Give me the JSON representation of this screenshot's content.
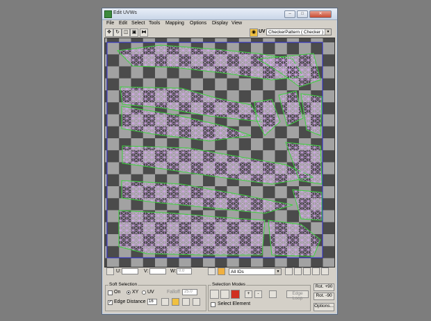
{
  "window": {
    "title": "Edit UVWs"
  },
  "menu": [
    "File",
    "Edit",
    "Select",
    "Tools",
    "Mapping",
    "Options",
    "Display",
    "View"
  ],
  "toolbar": {
    "uv_label": "UV",
    "texture_dropdown": "CheckerPattern  ( Checker )"
  },
  "statusbar": {
    "u_label": "U:",
    "v_label": "V:",
    "w_label": "W:",
    "w_value": "0.0",
    "ids_dropdown": "All IDs"
  },
  "soft_selection": {
    "title": "Soft Selection",
    "on_label": "On",
    "xy_label": "XY",
    "uv_label": "UV",
    "falloff_label": "Falloff",
    "falloff_value": "25.0",
    "edge_distance_label": "Edge Distance",
    "edge_distance_value": "16",
    "edge_distance_checked": true,
    "on_checked": false,
    "selected_space": "XY"
  },
  "selection_modes": {
    "title": "Selection Modes",
    "edge_loop_label": "Edge Loop",
    "select_element_label": "Select Element",
    "plus_label": "+",
    "minus_label": "-"
  },
  "right_buttons": {
    "rot_plus": "Rot. +90",
    "rot_minus": "Rot. -90",
    "options": "Options..."
  },
  "colors": {
    "checker_dark": "#4b4b4b",
    "checker_light": "#a0a0a0",
    "uv_edge": "#d8a8f0",
    "uv_border": "#39d639"
  }
}
